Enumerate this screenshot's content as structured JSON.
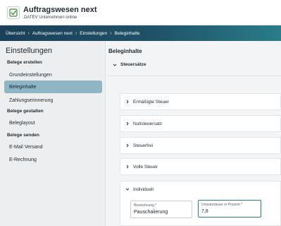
{
  "header": {
    "title": "Auftragswesen next",
    "subtitle": "DATEV Unternehmen online",
    "logo_icon": "datev-app-logo-icon"
  },
  "breadcrumb": [
    "Übersicht",
    "Auftragswesen next",
    "Einstellungen",
    "Beleginhalte"
  ],
  "sidebar": {
    "title": "Einstellungen",
    "sections": [
      {
        "label": "Belege erstellen",
        "items": [
          "Grundeinstellungen",
          "Beleginhalte",
          "Zahlungserinnerung"
        ]
      },
      {
        "label": "Belege gestalten",
        "items": [
          "Beleglayout"
        ]
      },
      {
        "label": "Belege senden",
        "items": [
          "E-Mail Versand",
          "E-Rechnung"
        ]
      }
    ],
    "active_item": "Beleginhalte"
  },
  "main": {
    "title": "Beleginhalte",
    "section_label": "Steuersätze",
    "panels": [
      {
        "label": "Ermäßigte Steuer",
        "expanded": false
      },
      {
        "label": "Nullsteuersatz",
        "expanded": false
      },
      {
        "label": "Steuerfrei",
        "expanded": false
      },
      {
        "label": "Volle Steuer",
        "expanded": false
      },
      {
        "label": "Individuell",
        "expanded": true
      }
    ],
    "fields": {
      "bezeichnung": {
        "label": "Bezeichnung *",
        "value": "Pauschalierung"
      },
      "umsatzsteuer": {
        "label": "Umsatzsteuer in Prozent *",
        "value": "7,8"
      }
    }
  },
  "colors": {
    "accent": "#2a7d89",
    "active_nav": "#8fb6c4",
    "breadcrumb_start": "#1b3f59",
    "breadcrumb_end": "#2a7d89"
  }
}
